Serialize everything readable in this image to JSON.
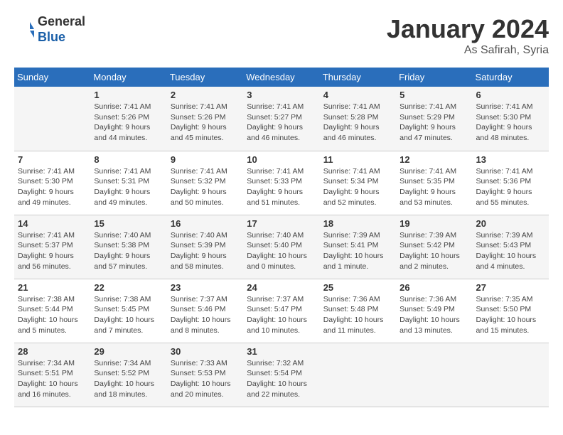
{
  "header": {
    "logo_line1": "General",
    "logo_line2": "Blue",
    "month": "January 2024",
    "location": "As Safirah, Syria"
  },
  "weekdays": [
    "Sunday",
    "Monday",
    "Tuesday",
    "Wednesday",
    "Thursday",
    "Friday",
    "Saturday"
  ],
  "weeks": [
    [
      null,
      {
        "day": 1,
        "sunrise": "7:41 AM",
        "sunset": "5:26 PM",
        "daylight": "9 hours and 44 minutes."
      },
      {
        "day": 2,
        "sunrise": "7:41 AM",
        "sunset": "5:26 PM",
        "daylight": "9 hours and 45 minutes."
      },
      {
        "day": 3,
        "sunrise": "7:41 AM",
        "sunset": "5:27 PM",
        "daylight": "9 hours and 46 minutes."
      },
      {
        "day": 4,
        "sunrise": "7:41 AM",
        "sunset": "5:28 PM",
        "daylight": "9 hours and 46 minutes."
      },
      {
        "day": 5,
        "sunrise": "7:41 AM",
        "sunset": "5:29 PM",
        "daylight": "9 hours and 47 minutes."
      },
      {
        "day": 6,
        "sunrise": "7:41 AM",
        "sunset": "5:30 PM",
        "daylight": "9 hours and 48 minutes."
      }
    ],
    [
      {
        "day": 7,
        "sunrise": "7:41 AM",
        "sunset": "5:30 PM",
        "daylight": "9 hours and 49 minutes."
      },
      {
        "day": 8,
        "sunrise": "7:41 AM",
        "sunset": "5:31 PM",
        "daylight": "9 hours and 49 minutes."
      },
      {
        "day": 9,
        "sunrise": "7:41 AM",
        "sunset": "5:32 PM",
        "daylight": "9 hours and 50 minutes."
      },
      {
        "day": 10,
        "sunrise": "7:41 AM",
        "sunset": "5:33 PM",
        "daylight": "9 hours and 51 minutes."
      },
      {
        "day": 11,
        "sunrise": "7:41 AM",
        "sunset": "5:34 PM",
        "daylight": "9 hours and 52 minutes."
      },
      {
        "day": 12,
        "sunrise": "7:41 AM",
        "sunset": "5:35 PM",
        "daylight": "9 hours and 53 minutes."
      },
      {
        "day": 13,
        "sunrise": "7:41 AM",
        "sunset": "5:36 PM",
        "daylight": "9 hours and 55 minutes."
      }
    ],
    [
      {
        "day": 14,
        "sunrise": "7:41 AM",
        "sunset": "5:37 PM",
        "daylight": "9 hours and 56 minutes."
      },
      {
        "day": 15,
        "sunrise": "7:40 AM",
        "sunset": "5:38 PM",
        "daylight": "9 hours and 57 minutes."
      },
      {
        "day": 16,
        "sunrise": "7:40 AM",
        "sunset": "5:39 PM",
        "daylight": "9 hours and 58 minutes."
      },
      {
        "day": 17,
        "sunrise": "7:40 AM",
        "sunset": "5:40 PM",
        "daylight": "10 hours and 0 minutes."
      },
      {
        "day": 18,
        "sunrise": "7:39 AM",
        "sunset": "5:41 PM",
        "daylight": "10 hours and 1 minute."
      },
      {
        "day": 19,
        "sunrise": "7:39 AM",
        "sunset": "5:42 PM",
        "daylight": "10 hours and 2 minutes."
      },
      {
        "day": 20,
        "sunrise": "7:39 AM",
        "sunset": "5:43 PM",
        "daylight": "10 hours and 4 minutes."
      }
    ],
    [
      {
        "day": 21,
        "sunrise": "7:38 AM",
        "sunset": "5:44 PM",
        "daylight": "10 hours and 5 minutes."
      },
      {
        "day": 22,
        "sunrise": "7:38 AM",
        "sunset": "5:45 PM",
        "daylight": "10 hours and 7 minutes."
      },
      {
        "day": 23,
        "sunrise": "7:37 AM",
        "sunset": "5:46 PM",
        "daylight": "10 hours and 8 minutes."
      },
      {
        "day": 24,
        "sunrise": "7:37 AM",
        "sunset": "5:47 PM",
        "daylight": "10 hours and 10 minutes."
      },
      {
        "day": 25,
        "sunrise": "7:36 AM",
        "sunset": "5:48 PM",
        "daylight": "10 hours and 11 minutes."
      },
      {
        "day": 26,
        "sunrise": "7:36 AM",
        "sunset": "5:49 PM",
        "daylight": "10 hours and 13 minutes."
      },
      {
        "day": 27,
        "sunrise": "7:35 AM",
        "sunset": "5:50 PM",
        "daylight": "10 hours and 15 minutes."
      }
    ],
    [
      {
        "day": 28,
        "sunrise": "7:34 AM",
        "sunset": "5:51 PM",
        "daylight": "10 hours and 16 minutes."
      },
      {
        "day": 29,
        "sunrise": "7:34 AM",
        "sunset": "5:52 PM",
        "daylight": "10 hours and 18 minutes."
      },
      {
        "day": 30,
        "sunrise": "7:33 AM",
        "sunset": "5:53 PM",
        "daylight": "10 hours and 20 minutes."
      },
      {
        "day": 31,
        "sunrise": "7:32 AM",
        "sunset": "5:54 PM",
        "daylight": "10 hours and 22 minutes."
      },
      null,
      null,
      null
    ]
  ]
}
